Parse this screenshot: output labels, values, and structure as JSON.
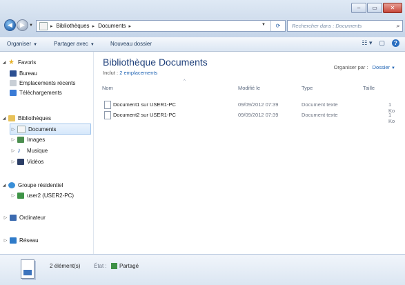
{
  "address": {
    "parts": [
      "Bibliothèques",
      "Documents"
    ]
  },
  "search": {
    "placeholder": "Rechercher dans : Documents"
  },
  "toolbar": {
    "organize": "Organiser",
    "share": "Partager avec",
    "new_folder": "Nouveau dossier"
  },
  "navigation": {
    "favorites": {
      "label": "Favoris",
      "items": [
        "Bureau",
        "Emplacements récents",
        "Téléchargements"
      ]
    },
    "libraries": {
      "label": "Bibliothèques",
      "items": [
        "Documents",
        "Images",
        "Musique",
        "Vidéos"
      ]
    },
    "homegroup": {
      "label": "Groupe résidentiel",
      "items": [
        "user2 (USER2-PC)"
      ]
    },
    "computer": "Ordinateur",
    "network": "Réseau"
  },
  "library": {
    "title": "Bibliothèque Documents",
    "includes_label": "Inclut :",
    "includes_link": "2 emplacements",
    "arrange_label": "Organiser par :",
    "arrange_value": "Dossier"
  },
  "columns": {
    "name": "Nom",
    "modified": "Modifié le",
    "type": "Type",
    "size": "Taille"
  },
  "files": [
    {
      "name": "Document1 sur USER1-PC",
      "modified": "09/09/2012 07:39",
      "type": "Document texte",
      "size": "1 Ko"
    },
    {
      "name": "Document2 sur USER1-PC",
      "modified": "09/09/2012 07:39",
      "type": "Document texte",
      "size": "1 Ko"
    }
  ],
  "details": {
    "count": "2 élément(s)",
    "state_label": "État :",
    "state_value": "Partagé"
  }
}
